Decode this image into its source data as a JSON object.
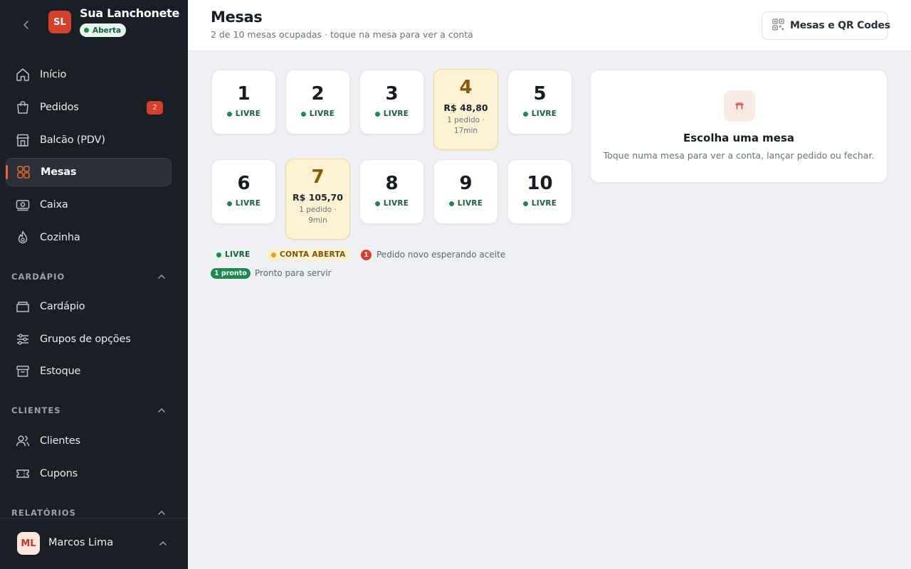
{
  "brand": {
    "initials": "SL",
    "name": "Sua Lanchonete",
    "status": "Aberta"
  },
  "nav": {
    "inicio": "Início",
    "pedidos": "Pedidos",
    "pedidos_badge": "2",
    "balcao": "Balcão (PDV)",
    "mesas": "Mesas",
    "caixa": "Caixa",
    "cozinha": "Cozinha"
  },
  "sections": {
    "cardapio": {
      "title": "CARDÁPIO",
      "items": [
        "Cardápio",
        "Grupos de opções",
        "Estoque"
      ]
    },
    "clientes": {
      "title": "CLIENTES",
      "items": [
        "Clientes",
        "Cupons"
      ]
    },
    "relatorios": {
      "title": "RELATÓRIOS"
    }
  },
  "user": {
    "initials": "ML",
    "name": "Marcos Lima"
  },
  "header": {
    "title": "Mesas",
    "subtitle": "2 de 10 mesas ocupadas · toque na mesa para ver a conta",
    "qr_button": "Mesas e QR Codes"
  },
  "tables": [
    {
      "number": "1",
      "status": "LIVRE"
    },
    {
      "number": "2",
      "status": "LIVRE"
    },
    {
      "number": "3",
      "status": "LIVRE"
    },
    {
      "number": "4",
      "amount": "R$ 48,80",
      "meta": "1 pedido · 17min"
    },
    {
      "number": "5",
      "status": "LIVRE"
    },
    {
      "number": "6",
      "status": "LIVRE"
    },
    {
      "number": "7",
      "amount": "R$ 105,70",
      "meta": "1 pedido · 9min"
    },
    {
      "number": "8",
      "status": "LIVRE"
    },
    {
      "number": "9",
      "status": "LIVRE"
    },
    {
      "number": "10",
      "status": "LIVRE"
    }
  ],
  "legend": {
    "free": "LIVRE",
    "open": "CONTA ABERTA",
    "new_badge": "1",
    "new_text": "Pedido novo esperando aceite",
    "ready_badge": "1 pronto",
    "ready_text": "Pronto para servir"
  },
  "panel": {
    "title": "Escolha uma mesa",
    "text": "Toque numa mesa para ver a conta, lançar pedido ou fechar."
  },
  "colors": {
    "sidebar_bg": "#1a1e25",
    "accent": "#e66a2c",
    "brand_red": "#d4402b",
    "free_green": "#1a8a4f",
    "open_amber": "#fdf2d3"
  }
}
